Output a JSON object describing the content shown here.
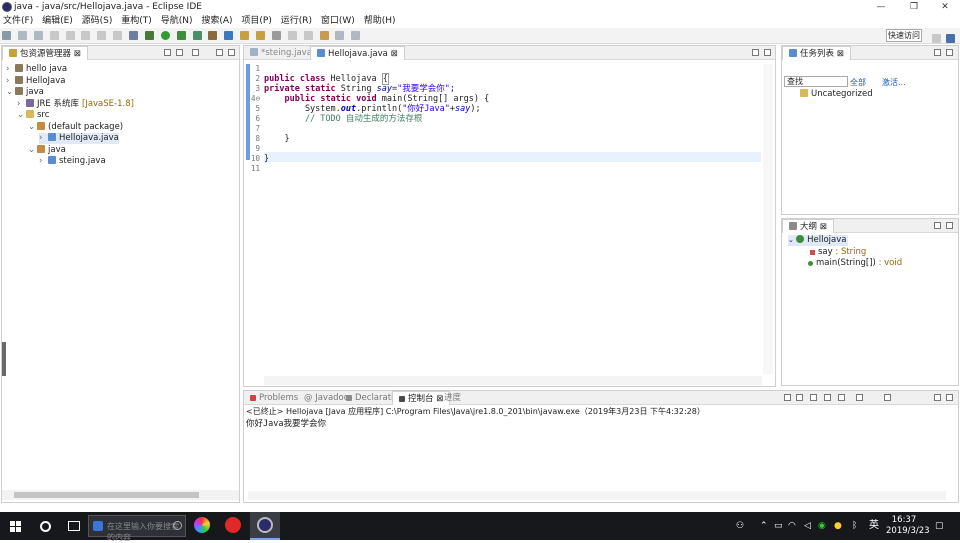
{
  "window": {
    "title": "java - java/src/Hellojava.java - Eclipse IDE",
    "min": "—",
    "max": "❐",
    "close": "✕"
  },
  "menu": [
    "文件(F)",
    "编辑(E)",
    "源码(S)",
    "重构(T)",
    "导航(N)",
    "搜索(A)",
    "项目(P)",
    "运行(R)",
    "窗口(W)",
    "帮助(H)"
  ],
  "quick_access": "快速访问",
  "explorer": {
    "tab": "包资源管理器 ⊠",
    "items": [
      {
        "label": "hello java",
        "level": 0,
        "twisty": "›",
        "icon": "project"
      },
      {
        "label": "HelloJava",
        "level": 0,
        "twisty": "›",
        "icon": "project"
      },
      {
        "label": "java",
        "level": 0,
        "twisty": "⌄",
        "icon": "project"
      },
      {
        "label": "JRE 系统库",
        "suffix": "[JavaSE-1.8]",
        "level": 1,
        "twisty": "›",
        "icon": "library"
      },
      {
        "label": "src",
        "level": 1,
        "twisty": "⌄",
        "icon": "folder"
      },
      {
        "label": "(default package)",
        "level": 2,
        "twisty": "⌄",
        "icon": "package"
      },
      {
        "label": "Hellojava.java",
        "level": 3,
        "twisty": "›",
        "icon": "file",
        "selected": true
      },
      {
        "label": "java",
        "level": 2,
        "twisty": "⌄",
        "icon": "package"
      },
      {
        "label": "steing.java",
        "level": 3,
        "twisty": "›",
        "icon": "file"
      }
    ]
  },
  "editor": {
    "tabs": [
      {
        "label": "*steing.java",
        "active": false
      },
      {
        "label": "Hellojava.java ⊠",
        "active": true
      }
    ],
    "line_numbers": [
      "1",
      "2",
      "3",
      "4⊖",
      "5",
      "6",
      "7",
      "8",
      "9",
      "10",
      "11"
    ]
  },
  "tasks": {
    "tab": "任务列表 ⊠",
    "search_placeholder": "查找",
    "all": "全部",
    "activate": "激活...",
    "category": "Uncategorized"
  },
  "outline": {
    "tab": "大纲 ⊠",
    "class_name": "Hellojava",
    "field_name": "say",
    "field_type": " : String",
    "method_name": "main(String[])",
    "method_type": " : void"
  },
  "console": {
    "tabs": [
      "Problems",
      "@ Javadoc",
      "Declaration",
      "控制台 ⊠",
      "进度"
    ],
    "header": "<已终止> Hellojava [Java 应用程序] C:\\Program Files\\Java\\jre1.8.0_201\\bin\\javaw.exe（2019年3月23日 下午4:32:28）",
    "output": "你好Java我要学会你"
  },
  "taskbar": {
    "search_placeholder": "在这里输入你要搜索的内容",
    "ime": "英",
    "time": "16:37",
    "date": "2019/3/23"
  }
}
